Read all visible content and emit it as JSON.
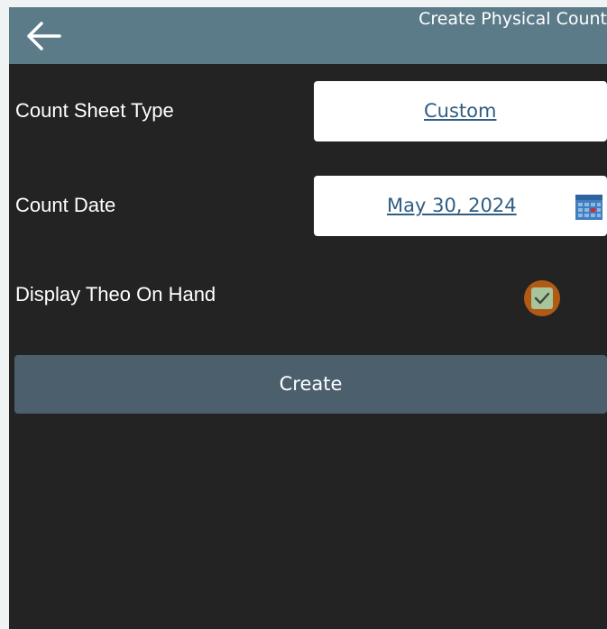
{
  "header": {
    "title": "Create Physical Count",
    "back_icon": "arrow-left-icon"
  },
  "form": {
    "sheet_type": {
      "label": "Count Sheet Type",
      "value": "Custom"
    },
    "count_date": {
      "label": "Count Date",
      "value": "May 30, 2024",
      "icon": "calendar-icon"
    },
    "display_theo": {
      "label": "Display Theo On Hand",
      "checked": true
    },
    "create_label": "Create"
  },
  "colors": {
    "header_bg": "#5c7b89",
    "body_bg": "#232323",
    "button_bg": "#4b5f6d",
    "link": "#2f5d83",
    "checkbox_ring": "#b25a14",
    "checkbox_fill": "#a8c49a"
  }
}
